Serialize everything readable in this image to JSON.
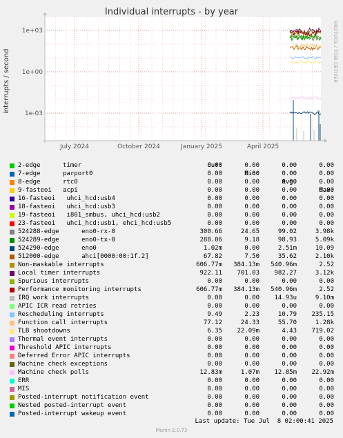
{
  "header": {
    "title": "Individual interrupts - by year",
    "ylabel": "interrupts / second",
    "watermark": "RRDTOOL / TOBI OETIKER"
  },
  "chart_data": {
    "type": "line",
    "title": "Individual interrupts - by year",
    "ylabel": "interrupts / second",
    "yscale": "log",
    "ylim": [
      1e-05,
      10000
    ],
    "y_ticks": [
      "1e+03",
      "1e+00",
      "1e-03"
    ],
    "x_ticks": [
      "July 2024",
      "October 2024",
      "January 2025",
      "April 2025"
    ],
    "grid": true,
    "series": [
      {
        "name": "524288-edge eno0-rx-0",
        "color": "#6a8a3c",
        "level": 300
      },
      {
        "name": "524289-edge eno0-tx-0",
        "color": "#00a000",
        "level": 290
      },
      {
        "name": "Local timer interrupts",
        "color": "#5e1d6a",
        "level": 920
      },
      {
        "name": "Non-maskable interrupts",
        "color": "#8e8e00",
        "level": 600
      },
      {
        "name": "Performance monitoring interrupts",
        "color": "#990000",
        "level": 600
      },
      {
        "name": "512000-edge ahci[0000:00:1f.2]",
        "color": "#b35a00",
        "level": 60
      },
      {
        "name": "Function call interrupts",
        "color": "#ffc880",
        "level": 70
      },
      {
        "name": "Rescheduling interrupts",
        "color": "#8fc7ef",
        "level": 10
      },
      {
        "name": "TLB shootdowns",
        "color": "#ffe680",
        "level": 5
      },
      {
        "name": "Machine check polls",
        "color": "#f4c8f8",
        "level": 0.0128
      },
      {
        "name": "524290-edge eno0",
        "color": "#0c4a76",
        "level": 0.001
      }
    ]
  },
  "legend": {
    "headers": [
      "Cur:",
      "Min:",
      "Avg:",
      "Max:"
    ],
    "rows": [
      {
        "label": "2-edge      timer",
        "color": "#00cc00",
        "cur": "0.00",
        "min": "0.00",
        "avg": "0.00",
        "max": "0.00"
      },
      {
        "label": "7-edge      parport0",
        "color": "#0066b3",
        "cur": "0.00",
        "min": "0.00",
        "avg": "0.00",
        "max": "0.00"
      },
      {
        "label": "8-edge      rtc0",
        "color": "#ff8000",
        "cur": "0.00",
        "min": "0.00",
        "avg": "0.00",
        "max": "0.00"
      },
      {
        "label": "9-fasteoi   acpi",
        "color": "#ffcc00",
        "cur": "0.00",
        "min": "0.00",
        "avg": "0.00",
        "max": "0.00"
      },
      {
        "label": "16-fasteoi   uhci_hcd:usb4",
        "color": "#330099",
        "cur": "0.00",
        "min": "0.00",
        "avg": "0.00",
        "max": "0.00"
      },
      {
        "label": "18-fasteoi   uhci_hcd:usb3",
        "color": "#990099",
        "cur": "0.00",
        "min": "0.00",
        "avg": "0.00",
        "max": "0.00"
      },
      {
        "label": "19-fasteoi   i801_smbus, uhci_hcd:usb2",
        "color": "#ccff00",
        "cur": "0.00",
        "min": "0.00",
        "avg": "0.00",
        "max": "0.00"
      },
      {
        "label": "23-fasteoi   uhci_hcd:usb1, ehci_hcd:usb5",
        "color": "#ff0000",
        "cur": "0.00",
        "min": "0.00",
        "avg": "0.00",
        "max": "0.00"
      },
      {
        "label": "524288-edge      eno0-rx-0",
        "color": "#808080",
        "cur": "300.66",
        "min": "24.65",
        "avg": "99.02",
        "max": "3.98k"
      },
      {
        "label": "524289-edge      eno0-tx-0",
        "color": "#008f00",
        "cur": "288.06",
        "min": "9.18",
        "avg": "98.93",
        "max": "5.09k"
      },
      {
        "label": "524290-edge      eno0",
        "color": "#00487d",
        "cur": "1.02m",
        "min": "0.00",
        "avg": "2.51m",
        "max": "10.09"
      },
      {
        "label": "512000-edge      ahci[0000:00:1f.2]",
        "color": "#b35a00",
        "cur": "67.82",
        "min": "7.50",
        "avg": "35.62",
        "max": "2.10k"
      },
      {
        "label": "Non-maskable interrupts",
        "color": "#b38f00",
        "cur": "606.77m",
        "min": "384.13m",
        "avg": "540.96m",
        "max": "2.52"
      },
      {
        "label": "Local timer interrupts",
        "color": "#6b006b",
        "cur": "922.11",
        "min": "701.03",
        "avg": "982.27",
        "max": "3.12k"
      },
      {
        "label": "Spurious interrupts",
        "color": "#8fb300",
        "cur": "0.00",
        "min": "0.00",
        "avg": "0.00",
        "max": "0.00"
      },
      {
        "label": "Performance monitoring interrupts",
        "color": "#b30000",
        "cur": "606.77m",
        "min": "384.13m",
        "avg": "540.96m",
        "max": "2.52"
      },
      {
        "label": "IRQ work interrupts",
        "color": "#bebebe",
        "cur": "0.00",
        "min": "0.00",
        "avg": "14.93u",
        "max": "9.10m"
      },
      {
        "label": "APIC ICR read retries",
        "color": "#80ff80",
        "cur": "0.00",
        "min": "0.00",
        "avg": "0.00",
        "max": "0.00"
      },
      {
        "label": "Rescheduling interrupts",
        "color": "#80c9ff",
        "cur": "9.49",
        "min": "2.23",
        "avg": "10.79",
        "max": "235.15"
      },
      {
        "label": "Function call interrupts",
        "color": "#ffc080",
        "cur": "77.12",
        "min": "24.33",
        "avg": "55.70",
        "max": "1.28k"
      },
      {
        "label": "TLB shootdowns",
        "color": "#ffe680",
        "cur": "6.35",
        "min": "22.09m",
        "avg": "4.43",
        "max": "719.02"
      },
      {
        "label": "Thermal event interrupts",
        "color": "#aa80ff",
        "cur": "0.00",
        "min": "0.00",
        "avg": "0.00",
        "max": "0.00"
      },
      {
        "label": "Threshold APIC interrupts",
        "color": "#ee00cc",
        "cur": "0.00",
        "min": "0.00",
        "avg": "0.00",
        "max": "0.00"
      },
      {
        "label": "Deferred Error APIC interrupts",
        "color": "#ff8080",
        "cur": "0.00",
        "min": "0.00",
        "avg": "0.00",
        "max": "0.00"
      },
      {
        "label": "Machine check exceptions",
        "color": "#666600",
        "cur": "0.00",
        "min": "0.00",
        "avg": "0.00",
        "max": "0.00"
      },
      {
        "label": "Machine check polls",
        "color": "#ffbfff",
        "cur": "12.83m",
        "min": "1.07m",
        "avg": "12.85m",
        "max": "22.92m"
      },
      {
        "label": "ERR",
        "color": "#00ffcc",
        "cur": "0.00",
        "min": "0.00",
        "avg": "0.00",
        "max": "0.00"
      },
      {
        "label": "MIS",
        "color": "#cc6699",
        "cur": "0.00",
        "min": "0.00",
        "avg": "0.00",
        "max": "0.00"
      },
      {
        "label": "Posted-interrupt notification event",
        "color": "#999900",
        "cur": "0.00",
        "min": "0.00",
        "avg": "0.00",
        "max": "0.00"
      },
      {
        "label": "Nested posted-interrupt event",
        "color": "#00cc00",
        "cur": "0.00",
        "min": "0.00",
        "avg": "0.00",
        "max": "0.00"
      },
      {
        "label": "Posted-interrupt wakeup event",
        "color": "#0066b3",
        "cur": "0.00",
        "min": "0.00",
        "avg": "0.00",
        "max": "0.00"
      }
    ]
  },
  "footer": {
    "last_update": "Last update: Tue Jul  8 02:00:41 2025",
    "version": "Munin 2.0.73"
  }
}
